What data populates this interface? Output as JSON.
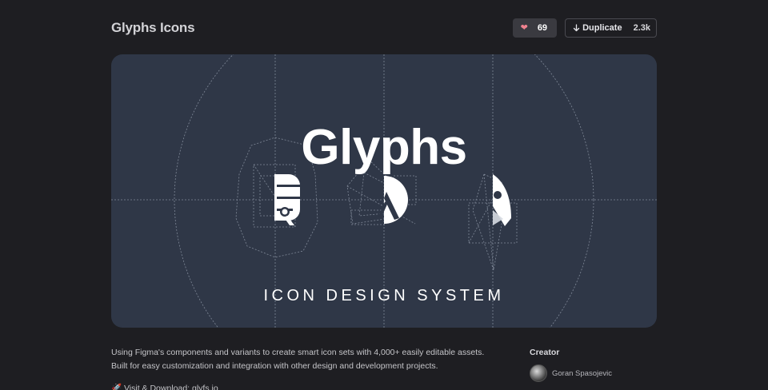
{
  "header": {
    "title": "Glyphs Icons",
    "like_icon": "heart-icon",
    "like_count": "69",
    "duplicate_icon": "arrow-down-icon",
    "duplicate_label": "Duplicate",
    "duplicate_count": "2.3k"
  },
  "hero": {
    "title": "Glyphs",
    "tagline": "ICON DESIGN SYSTEM",
    "background": "#2f3747"
  },
  "description": {
    "text": "Using Figma's components and variants to create smart icon sets with 4,000+ easily editable assets. Built for easy customization and integration with other design and development projects.",
    "visit_text": "🚀 Visit & Download: glyfs.io"
  },
  "creator": {
    "label": "Creator",
    "name": "Goran Spasojevic"
  }
}
